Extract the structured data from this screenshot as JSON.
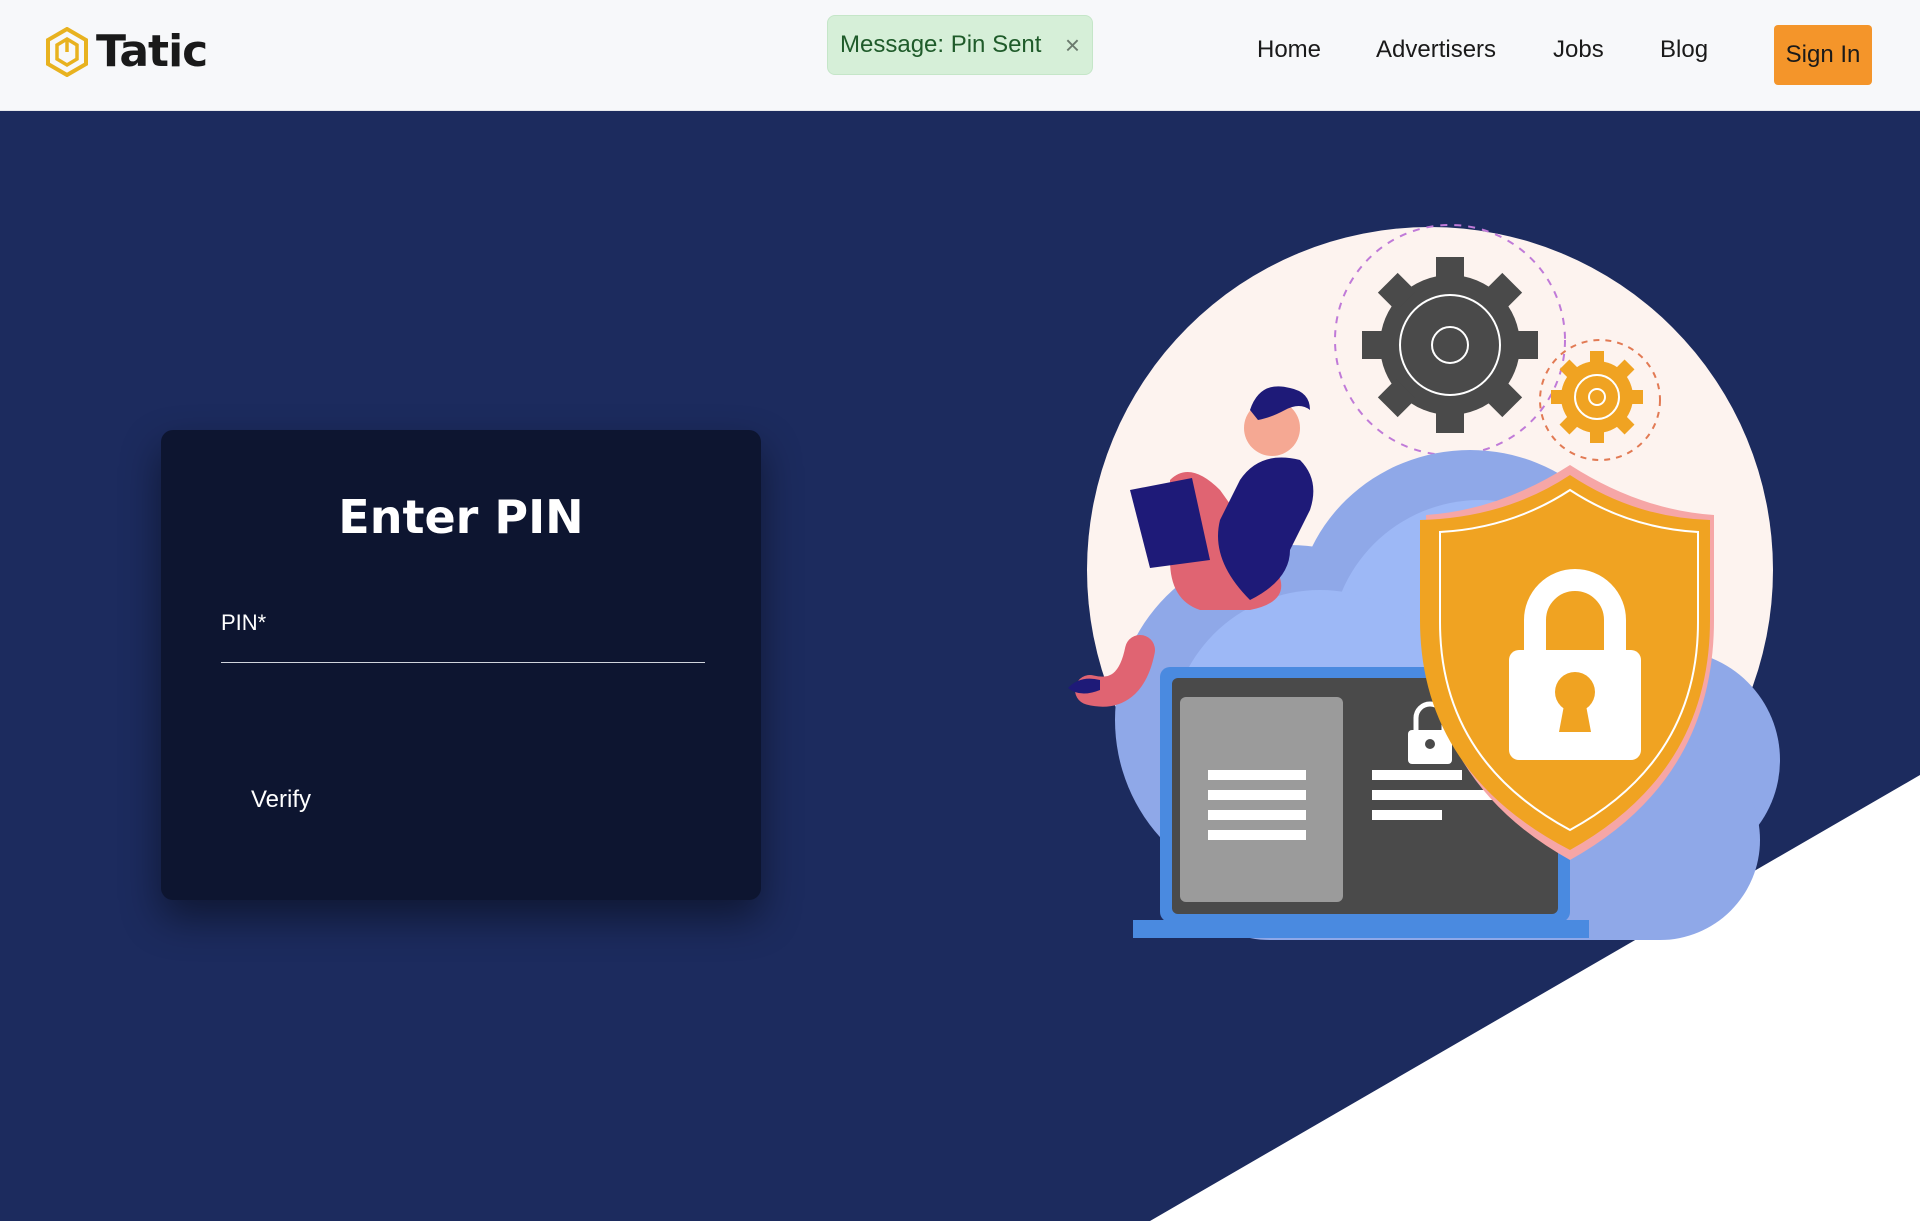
{
  "brand": {
    "name": "Tatic",
    "logo_icon": "hexagon-logo-icon",
    "accent": "#e8b21f"
  },
  "toast": {
    "text": "Message: Pin Sent",
    "close_icon": "close-icon",
    "close_glyph": "×",
    "bg": "#d6efd8"
  },
  "nav": {
    "items": [
      {
        "label": "Home"
      },
      {
        "label": "Advertisers"
      },
      {
        "label": "Jobs"
      },
      {
        "label": "Blog"
      }
    ],
    "signin_label": "Sign In",
    "signin_color": "#f4952a"
  },
  "form": {
    "title": "Enter PIN",
    "pin_label": "PIN*",
    "pin_value": "",
    "verify_label": "Verify"
  },
  "colors": {
    "background": "#1c2b5e",
    "card": "#0d1530",
    "navbar": "#f7f8fa"
  },
  "illustration": {
    "icon": "cloud-security-illustration"
  }
}
